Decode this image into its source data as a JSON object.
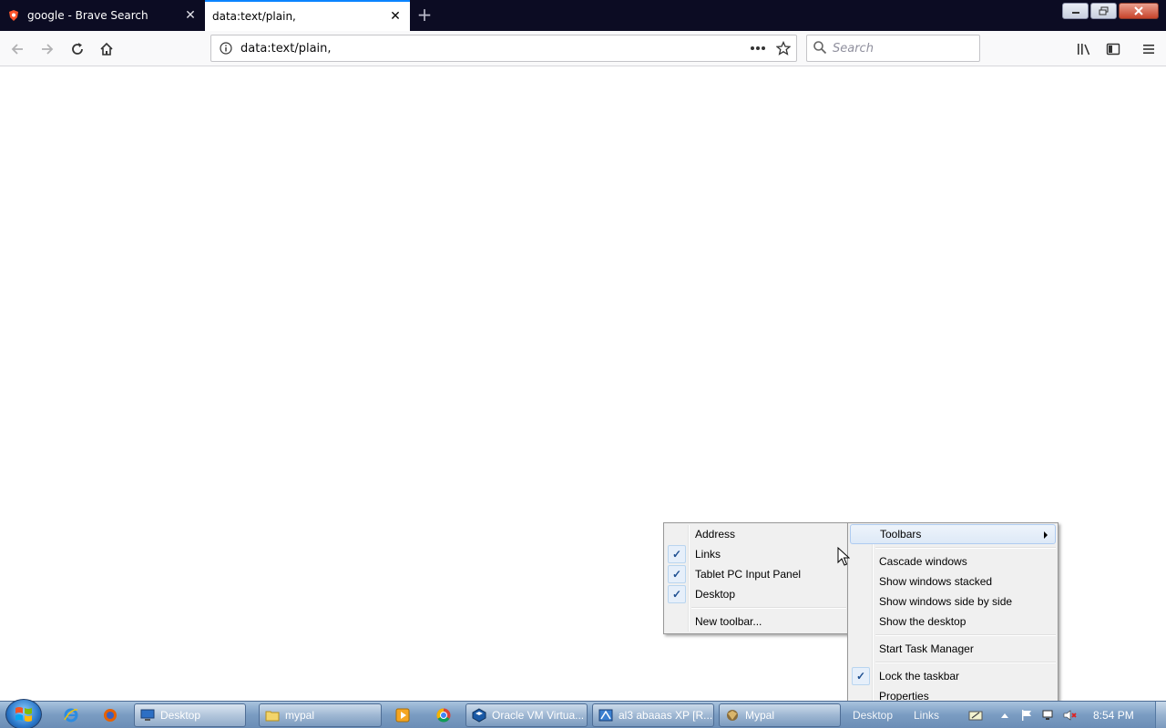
{
  "browser": {
    "tabs": [
      {
        "title": "google - Brave Search",
        "favicon": "brave-lion-icon",
        "active": false
      },
      {
        "title": "data:text/plain,",
        "active": true
      }
    ],
    "new_tab_label": "+",
    "urlbar": {
      "value": "data:text/plain,"
    },
    "search": {
      "placeholder": "Search"
    }
  },
  "toolbars_submenu": {
    "items": [
      {
        "label": "Address",
        "checked": false
      },
      {
        "label": "Links",
        "checked": true
      },
      {
        "label": "Tablet PC Input Panel",
        "checked": true
      },
      {
        "label": "Desktop",
        "checked": true
      },
      {
        "label": "New toolbar...",
        "checked": false
      }
    ]
  },
  "taskbar_menu": {
    "toolbars": "Toolbars",
    "cascade": "Cascade windows",
    "stacked": "Show windows stacked",
    "side_by_side": "Show windows side by side",
    "show_desktop": "Show the desktop",
    "task_manager": "Start Task Manager",
    "lock": "Lock the taskbar",
    "lock_checked": true,
    "properties": "Properties"
  },
  "taskbar": {
    "tasks": [
      {
        "label": "Desktop",
        "icon": "desktop-icon"
      },
      {
        "label": "mypal",
        "icon": "folder-icon"
      },
      {
        "label": "Oracle VM Virtua...",
        "icon": "virtualbox-icon"
      },
      {
        "label": "al3 abaaas XP [R...",
        "icon": "vm-window-icon"
      },
      {
        "label": "Mypal",
        "icon": "mypal-icon"
      }
    ],
    "toolbar_labels": {
      "desktop": "Desktop",
      "links": "Links"
    },
    "clock": "8:54 PM"
  },
  "colors": {
    "tabstrip": "#0c0c23",
    "accent": "#0a84ff",
    "taskbar": "#7a9cc2",
    "check": "#1e4f91"
  }
}
